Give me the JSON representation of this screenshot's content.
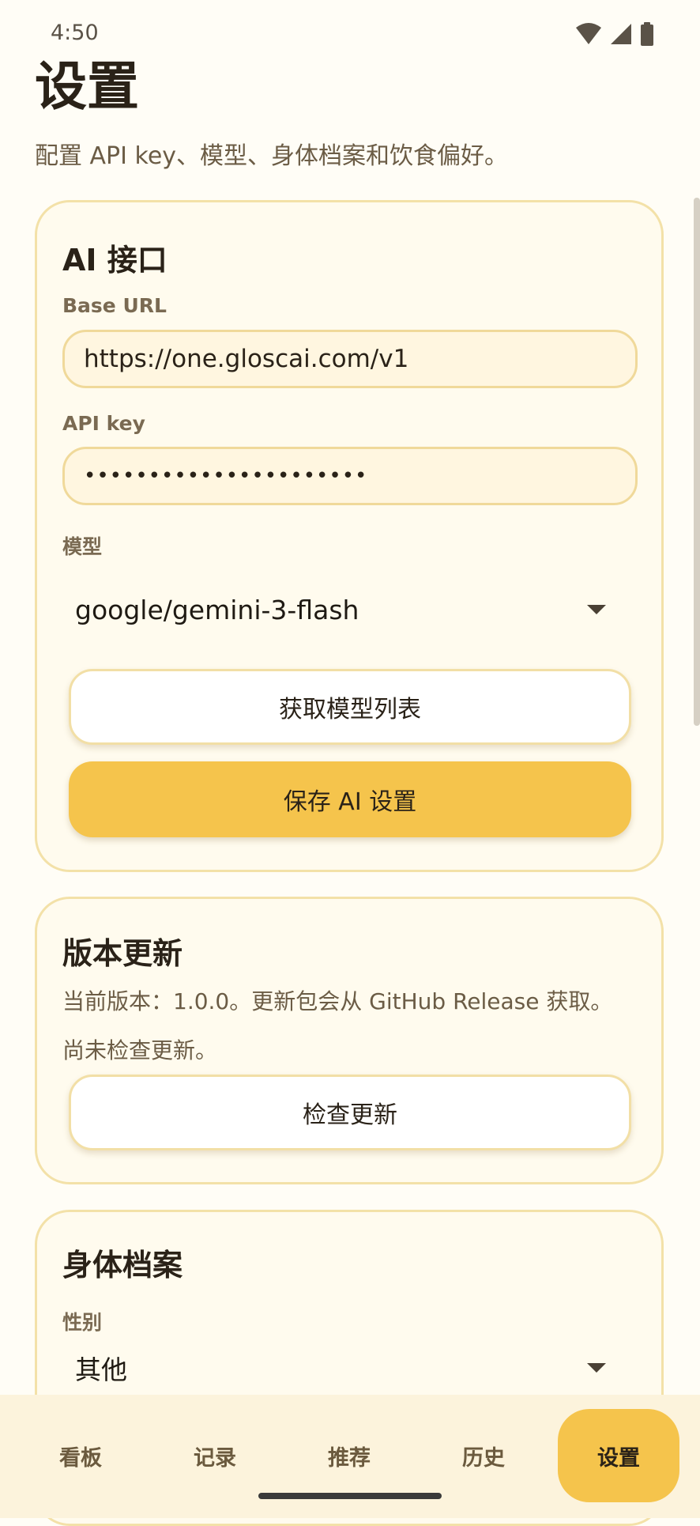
{
  "status_bar": {
    "time": "4:50",
    "icons": [
      "wifi-icon",
      "signal-icon",
      "battery-icon"
    ]
  },
  "page": {
    "title": "设置",
    "subtitle": "配置 API key、模型、身体档案和饮食偏好。"
  },
  "ai_card": {
    "title": "AI 接口",
    "base_url_label": "Base URL",
    "base_url_value": "https://one.gloscai.com/v1",
    "api_key_label": "API key",
    "api_key_value": "••••••••••••••••••••••",
    "model_label": "模型",
    "model_value": "google/gemini-3-flash",
    "fetch_models_label": "获取模型列表",
    "save_label": "保存 AI 设置"
  },
  "update_card": {
    "title": "版本更新",
    "version_text": "当前版本：1.0.0。更新包会从 GitHub Release 获取。",
    "status_text": "尚未检查更新。",
    "check_label": "检查更新"
  },
  "profile_card": {
    "title": "身体档案",
    "gender_label": "性别",
    "gender_value": "其他"
  },
  "bottom_nav": {
    "items": [
      {
        "label": "看板"
      },
      {
        "label": "记录"
      },
      {
        "label": "推荐"
      },
      {
        "label": "历史"
      },
      {
        "label": "设置"
      }
    ],
    "active_index": 4
  },
  "colors": {
    "accent": "#f5c44c",
    "background": "#fffdf6",
    "card_border": "#f3e1a8",
    "nav_background": "#fcf3dc"
  }
}
